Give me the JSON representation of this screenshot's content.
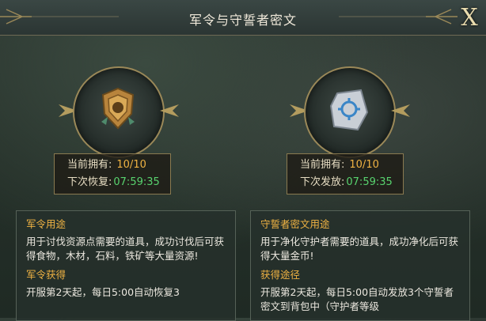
{
  "window": {
    "title": "军令与守誓者密文",
    "close_label": "X"
  },
  "left_item": {
    "icon": "bronze-badge-icon",
    "owned_label": "当前拥有:",
    "owned_value": "10/10",
    "timer_label": "下次恢复:",
    "timer_value": "07:59:35"
  },
  "right_item": {
    "icon": "rune-stone-icon",
    "owned_label": "当前拥有:",
    "owned_value": "10/10",
    "timer_label": "下次发放:",
    "timer_value": "07:59:35"
  },
  "left_panel": {
    "usage_heading": "军令用途",
    "usage_text": "用于讨伐资源点需要的道具，成功讨伐后可获得食物，木材，石料，铁矿等大量资源!",
    "obtain_heading": "军令获得",
    "obtain_text": "开服第2天起，每日5:00自动恢复3"
  },
  "right_panel": {
    "usage_heading": "守誓者密文用途",
    "usage_text": "用于净化守护者需要的道具，成功净化后可获得大量金币!",
    "obtain_heading": "获得途径",
    "obtain_text": "开服第2天起，每日5:00自动发放3个守誓者密文到背包中（守护者等级"
  },
  "colors": {
    "accent_orange": "#f0b343",
    "timer_green": "#58d36e",
    "frame_gold": "#9a8858"
  }
}
